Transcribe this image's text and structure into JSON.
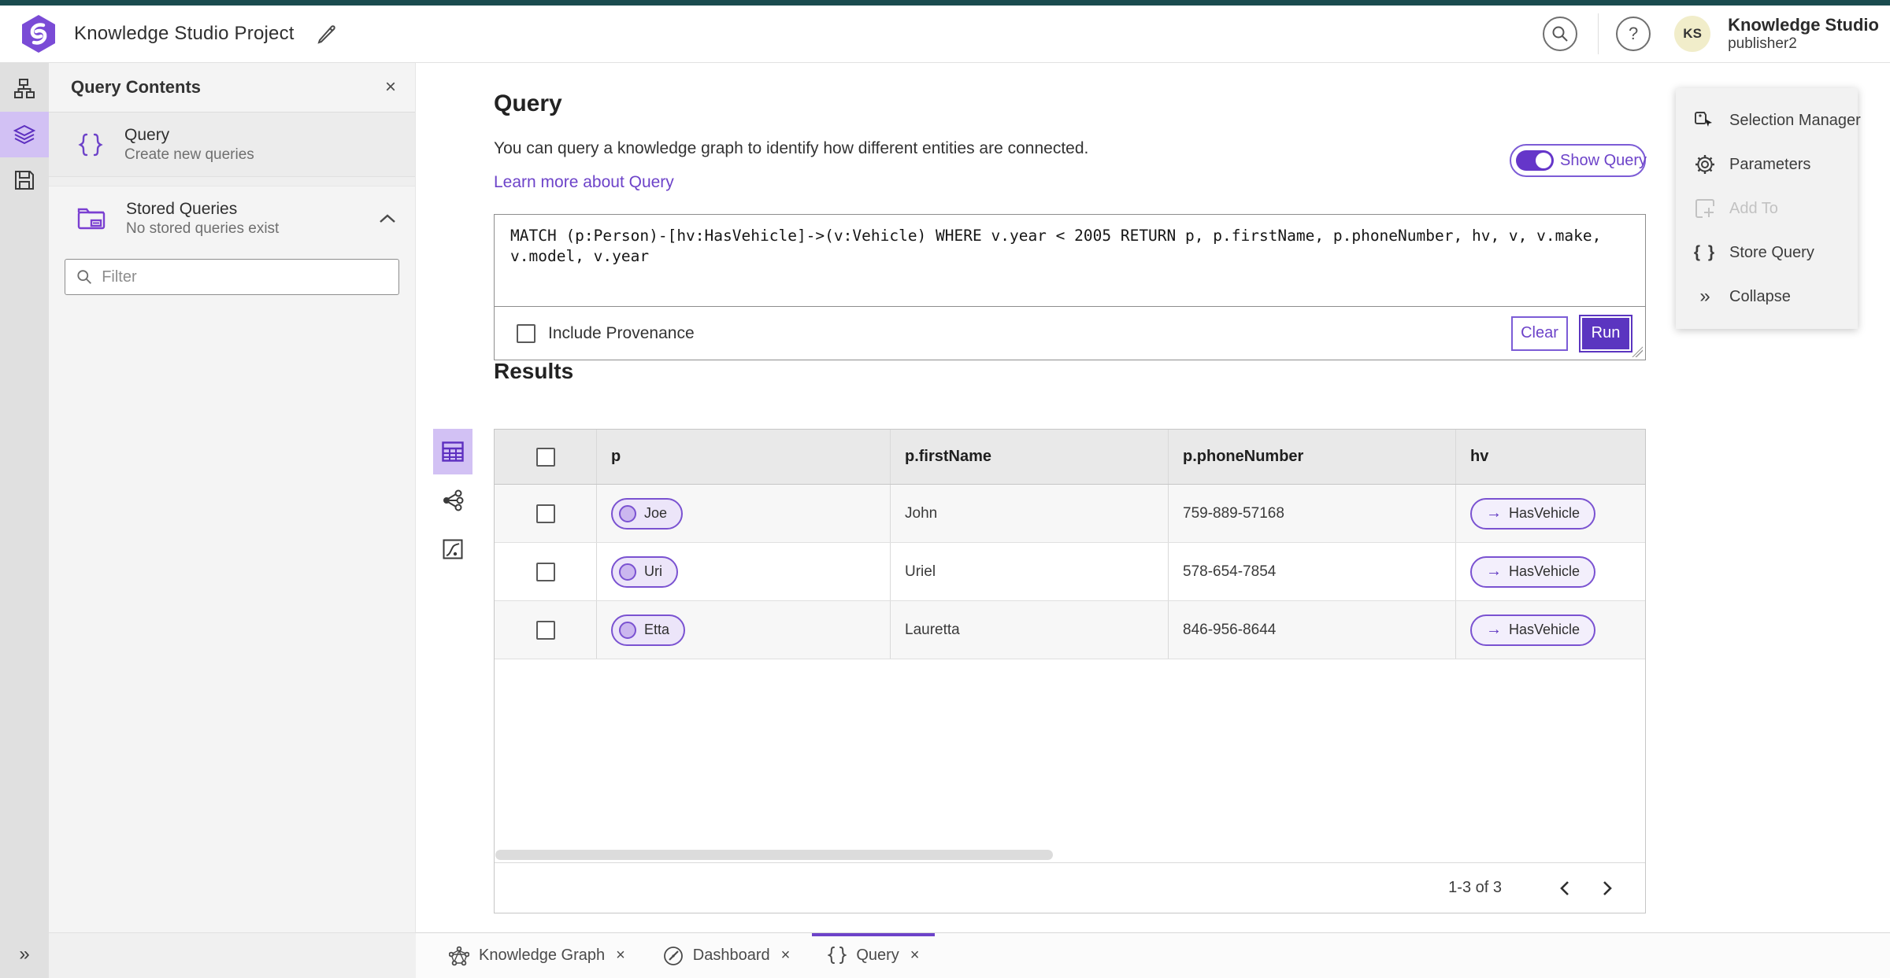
{
  "header": {
    "title": "Knowledge Studio Project",
    "product": "Knowledge Studio",
    "username": "publisher2",
    "avatar_initials": "KS"
  },
  "left_panel": {
    "title": "Query Contents",
    "items": [
      {
        "label": "Query",
        "sublabel": "Create new queries"
      },
      {
        "label": "Stored Queries",
        "sublabel": "No stored queries exist"
      }
    ],
    "filter_placeholder": "Filter"
  },
  "query_section": {
    "heading": "Query",
    "description": "You can query a knowledge graph to identify how different entities are connected.",
    "learn_more": "Learn more about Query",
    "show_query_label": "Show Query",
    "query_text": "MATCH (p:Person)-[hv:HasVehicle]->(v:Vehicle) WHERE v.year < 2005 RETURN p, p.firstName, p.phoneNumber, hv, v, v.make, v.model, v.year",
    "include_provenance_label": "Include Provenance",
    "clear_label": "Clear",
    "run_label": "Run"
  },
  "results": {
    "heading": "Results",
    "columns": [
      "p",
      "p.firstName",
      "p.phoneNumber",
      "hv"
    ],
    "rows": [
      {
        "p": "Joe",
        "firstName": "John",
        "phoneNumber": "759-889-57168",
        "hv": "HasVehicle",
        "arrow": "→"
      },
      {
        "p": "Uri",
        "firstName": "Uriel",
        "phoneNumber": "578-654-7854",
        "hv": "HasVehicle",
        "arrow": "→"
      },
      {
        "p": "Etta",
        "firstName": "Lauretta",
        "phoneNumber": "846-956-8644",
        "hv": "HasVehicle",
        "arrow": "→"
      }
    ],
    "pagination": "1-3 of 3"
  },
  "right_menu": {
    "items": [
      {
        "label": "Selection Manager",
        "disabled": false
      },
      {
        "label": "Parameters",
        "disabled": false
      },
      {
        "label": "Add To",
        "disabled": true
      },
      {
        "label": "Store Query",
        "disabled": false
      },
      {
        "label": "Collapse",
        "disabled": false
      }
    ]
  },
  "tabs": [
    {
      "label": "Knowledge Graph"
    },
    {
      "label": "Dashboard"
    },
    {
      "label": "Query"
    }
  ],
  "glyphs": {
    "close": "×",
    "collapse": "»",
    "braces": "{ }",
    "help": "?"
  },
  "colors": {
    "primary_purple": "#5b35c0",
    "link_purple": "#6d43c9",
    "pill_border": "#7a52d1",
    "pill_bg": "#ece5f9",
    "top_strip_teal": "#1a4b4f",
    "avatar_bg": "#f1edca",
    "rail_selected_bg": "#d2c1f4"
  }
}
